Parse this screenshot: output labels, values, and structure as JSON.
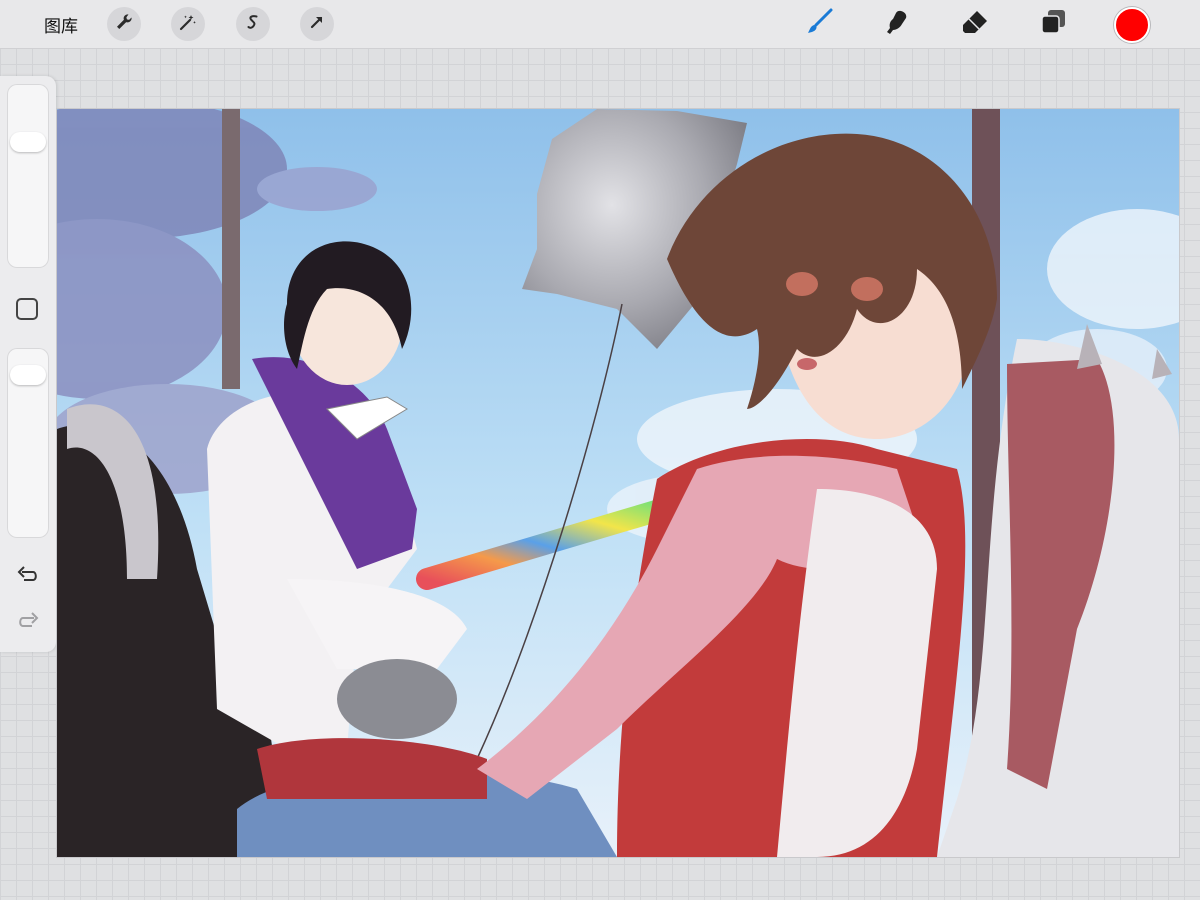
{
  "toolbar": {
    "gallery_label": "图库",
    "left_tools": [
      "wrench-icon",
      "magic-wand-icon",
      "selection-icon",
      "transform-arrow-icon"
    ],
    "right_tools": [
      "brush-icon",
      "smudge-icon",
      "eraser-icon",
      "layers-icon"
    ],
    "active_tool": "brush-icon",
    "current_color": "#ff0000",
    "accent_color": "#1a7bd6"
  },
  "sidebar": {
    "brush_size_level": 0.72,
    "opacity_level": 0.92,
    "controls": [
      "brush-size-slider",
      "modify-button",
      "opacity-slider",
      "undo-icon",
      "redo-icon"
    ]
  },
  "canvas": {
    "content": "illustration"
  }
}
